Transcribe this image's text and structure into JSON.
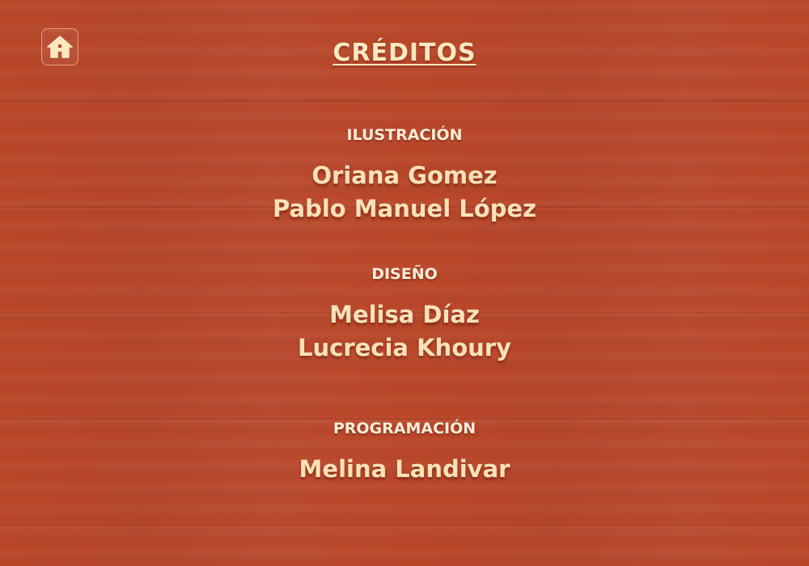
{
  "home_button": {
    "icon": "home-icon",
    "border_color": "#e8a27c",
    "icon_color": "#fde8c0"
  },
  "title": "CRÉDITOS",
  "sections": [
    {
      "label": "ILUSTRACIÓN",
      "names": [
        "Oriana Gomez",
        "Pablo Manuel López"
      ]
    },
    {
      "label": "DISEÑO",
      "names": [
        "Melisa Díaz",
        "Lucrecia Khoury"
      ]
    },
    {
      "label": "PROGRAMACIÓN",
      "names": [
        "Melina Landivar"
      ]
    }
  ],
  "colors": {
    "background": "#b9472a",
    "text": "#fde8c0"
  }
}
